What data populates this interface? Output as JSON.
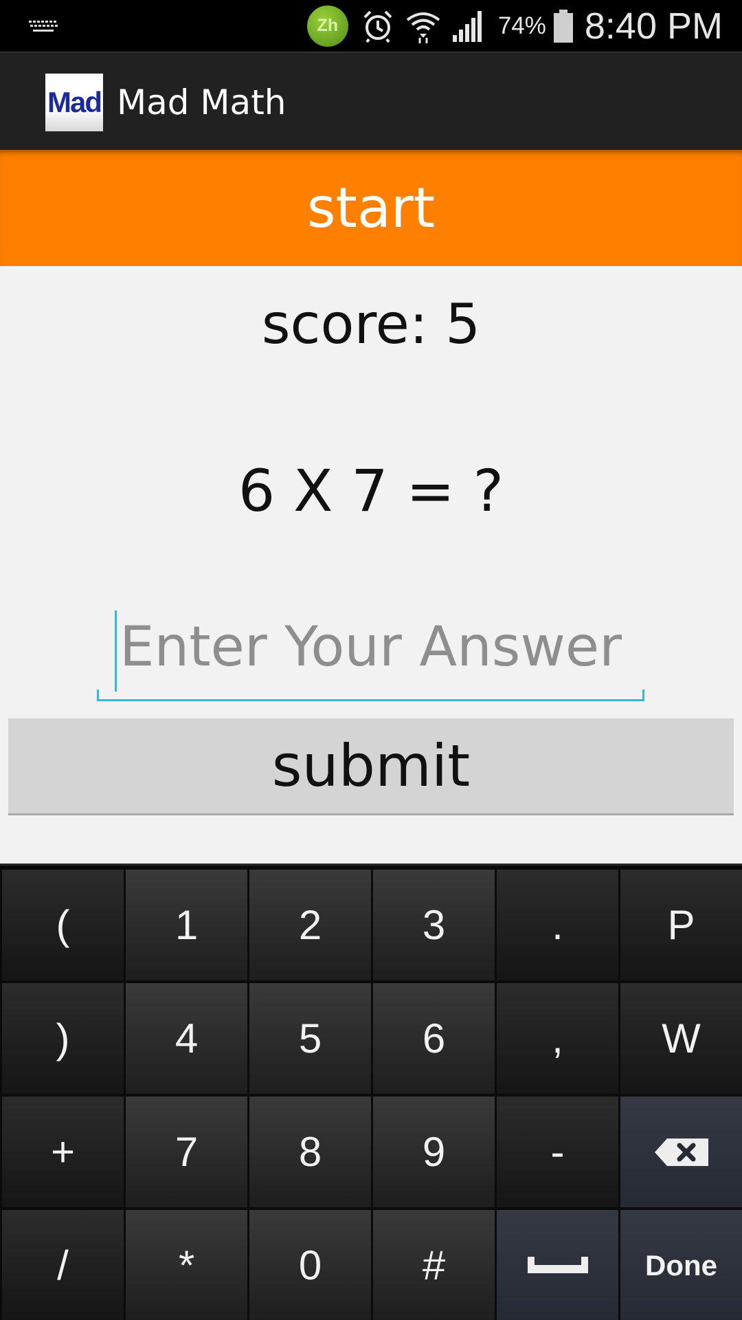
{
  "status_bar": {
    "input_method_badge": "Zh",
    "battery_percent": "74%",
    "time": "8:40 PM",
    "icons": [
      "keyboard-icon",
      "zh-input-icon",
      "alarm-icon",
      "wifi-icon",
      "signal-icon",
      "battery-icon"
    ]
  },
  "action_bar": {
    "app_icon_text": "Mad",
    "title": "Mad Math"
  },
  "main": {
    "start_label": "start",
    "score_text": "score: 5",
    "question_text": "6 X 7 = ?",
    "answer_placeholder": "Enter Your Answer",
    "answer_value": "",
    "submit_label": "submit"
  },
  "keyboard": {
    "rows": [
      [
        "(",
        "1",
        "2",
        "3",
        ".",
        "P"
      ],
      [
        ")",
        "4",
        "5",
        "6",
        ",",
        "W"
      ],
      [
        "+",
        "7",
        "8",
        "9",
        "-",
        "backspace"
      ],
      [
        "/",
        "*",
        "0",
        "#",
        "space",
        "Done"
      ]
    ]
  },
  "colors": {
    "accent_orange": "#ff8000",
    "focus_blue": "#33b5e5",
    "action_bar": "#212121",
    "keyboard_bg": "#0b0b0b"
  }
}
